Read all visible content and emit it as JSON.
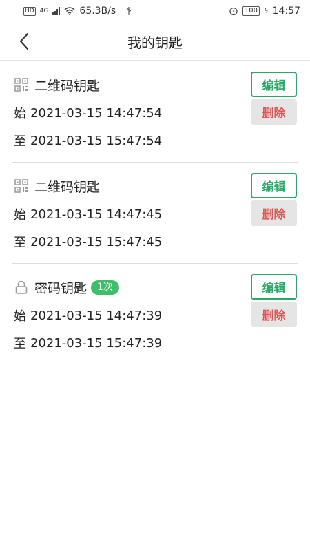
{
  "status_bar": {
    "hd": "HD",
    "network": "4G",
    "speed": "65.3B/s",
    "battery": "100",
    "time": "14:57"
  },
  "header": {
    "title": "我的钥匙"
  },
  "keys": [
    {
      "type_icon": "qr-code-icon",
      "type_label": "二维码钥匙",
      "badge": "",
      "start_prefix": "始",
      "start": "2021-03-15 14:47:54",
      "end_prefix": "至",
      "end": "2021-03-15 15:47:54",
      "edit_label": "编辑",
      "delete_label": "删除"
    },
    {
      "type_icon": "qr-code-icon",
      "type_label": "二维码钥匙",
      "badge": "",
      "start_prefix": "始",
      "start": "2021-03-15 14:47:45",
      "end_prefix": "至",
      "end": "2021-03-15 15:47:45",
      "edit_label": "编辑",
      "delete_label": "删除"
    },
    {
      "type_icon": "lock-icon",
      "type_label": "密码钥匙",
      "badge": "1次",
      "start_prefix": "始",
      "start": "2021-03-15 14:47:39",
      "end_prefix": "至",
      "end": "2021-03-15 15:47:39",
      "edit_label": "编辑",
      "delete_label": "删除"
    }
  ],
  "colors": {
    "accent_green": "#2aa866",
    "badge_green": "#3dbf6a",
    "delete_red": "#e05555",
    "delete_bg": "#e5e5e5"
  }
}
